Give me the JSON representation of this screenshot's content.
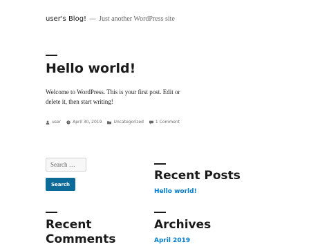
{
  "header": {
    "site_title": "user's Blog!",
    "separator": "—",
    "tagline": "Just another WordPress site"
  },
  "post": {
    "title": "Hello world!",
    "content": "Welcome to WordPress. This is your first post. Edit or delete it, then start writing!",
    "meta": {
      "author": "user",
      "date": "April 30, 2019",
      "category": "Uncategorized",
      "comments": "1 Comment"
    }
  },
  "sidebar": {
    "search": {
      "placeholder": "Search …",
      "button_label": "Search"
    },
    "recent_posts": {
      "title": "Recent Posts",
      "items": [
        "Hello world!"
      ]
    },
    "recent_comments": {
      "title_line1": "Recent",
      "title_line2": "Comments"
    },
    "archives": {
      "title": "Archives",
      "items": [
        "April 2019"
      ]
    }
  },
  "colors": {
    "link": "#007acc",
    "button": "#0d6b9a",
    "text": "#1a1a1a",
    "muted": "#686868"
  },
  "icons": {
    "author": "person-icon",
    "date": "clock-icon",
    "category": "folder-icon",
    "comments": "comment-icon"
  }
}
